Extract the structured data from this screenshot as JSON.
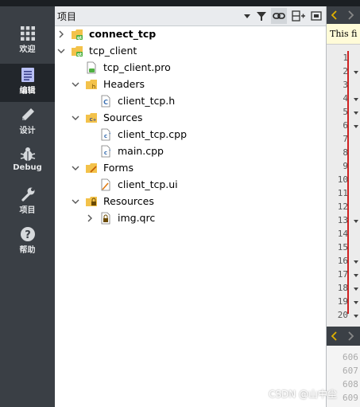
{
  "mode_bar": [
    {
      "label": "欢迎",
      "icon": "grid-icon"
    },
    {
      "label": "编辑",
      "icon": "document-edit-icon",
      "active": true
    },
    {
      "label": "设计",
      "icon": "pencil-icon"
    },
    {
      "label": "Debug",
      "icon": "bug-icon"
    },
    {
      "label": "项目",
      "icon": "wrench-icon"
    },
    {
      "label": "帮助",
      "icon": "help-icon"
    }
  ],
  "projects_panel": {
    "title": "项目",
    "toolbar_icons": [
      "dropdown-arrow-icon",
      "filter-icon",
      "link-icon",
      "split-icon",
      "close-panel-icon"
    ]
  },
  "tree": [
    {
      "label": "connect_tcp",
      "bold": true,
      "icon": "qt-project-folder-icon",
      "expanded": false
    },
    {
      "label": "tcp_client",
      "icon": "qt-project-folder-icon",
      "expanded": true
    },
    {
      "label": "tcp_client.pro",
      "icon": "pro-file-icon"
    },
    {
      "label": "Headers",
      "icon": "headers-folder-icon",
      "expanded": true
    },
    {
      "label": "client_tcp.h",
      "icon": "header-file-icon"
    },
    {
      "label": "Sources",
      "icon": "sources-folder-icon",
      "expanded": true
    },
    {
      "label": "client_tcp.cpp",
      "icon": "cpp-file-icon"
    },
    {
      "label": "main.cpp",
      "icon": "cpp-file-icon"
    },
    {
      "label": "Forms",
      "icon": "forms-folder-icon",
      "expanded": true
    },
    {
      "label": "client_tcp.ui",
      "icon": "ui-file-icon"
    },
    {
      "label": "Resources",
      "icon": "resources-folder-icon",
      "expanded": true
    },
    {
      "label": "img.qrc",
      "icon": "qrc-file-icon",
      "expanded": false
    }
  ],
  "editor": {
    "file_hint": "This fi",
    "line_numbers": [
      "1",
      "2",
      "3",
      "4",
      "5",
      "6",
      "7",
      "8",
      "9",
      "10",
      "11",
      "12",
      "13",
      "14",
      "15",
      "16",
      "17",
      "18",
      "19",
      "20"
    ],
    "fold_lines": [
      "2",
      "4",
      "5",
      "6",
      "13",
      "16",
      "17",
      "18",
      "19",
      "20"
    ],
    "lower_line_numbers": [
      "606",
      "607",
      "608",
      "609"
    ]
  },
  "watermark": "CSDN @山中尘",
  "colors": {
    "mode_bar_bg": "#3a3f45",
    "mode_active_bg": "#22262b",
    "accent_red": "#d02020"
  }
}
